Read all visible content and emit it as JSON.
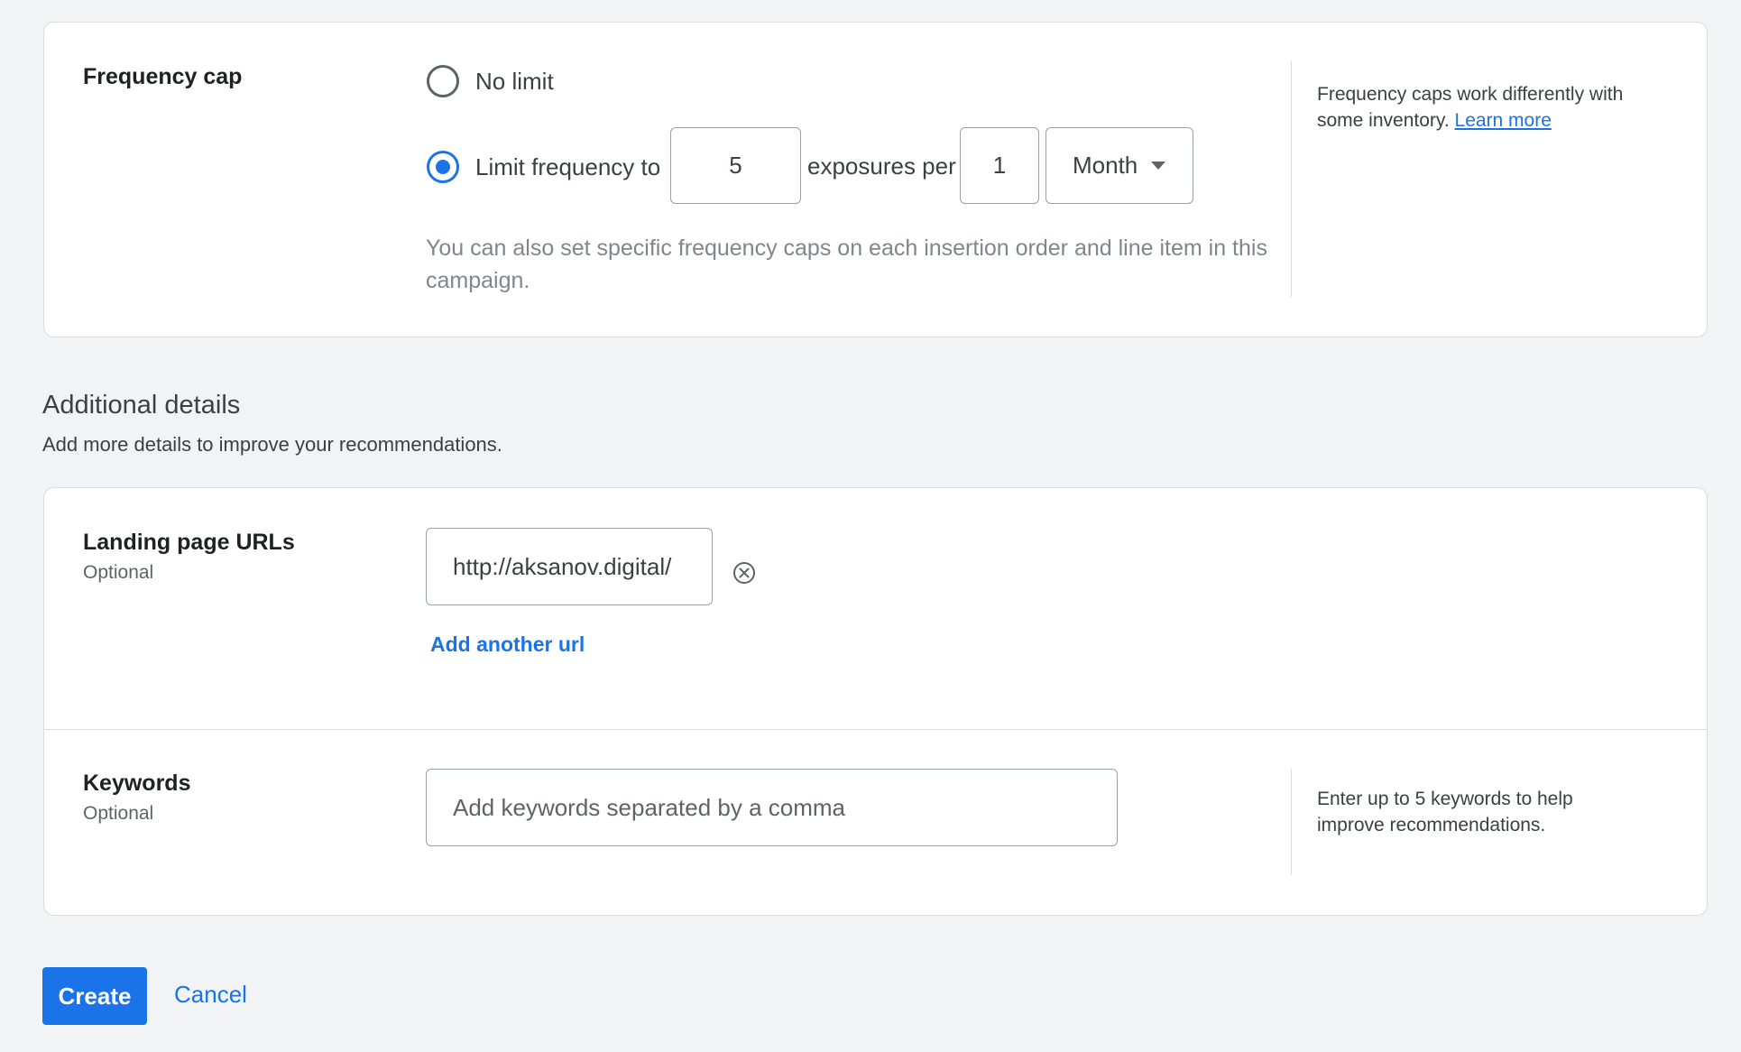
{
  "frequency": {
    "title": "Frequency cap",
    "options": [
      {
        "label": "No limit",
        "selected": false
      },
      {
        "label": "Limit frequency to",
        "selected": true
      }
    ],
    "exposures_value": "5",
    "exposures_label": "exposures per",
    "period_count": "1",
    "period_unit": "Month",
    "hint": "You can also set specific frequency caps on each insertion order and line item in this campaign.",
    "help_text": "Frequency caps work differently with some inventory.",
    "help_link": "Learn more"
  },
  "additional": {
    "title": "Additional details",
    "subtitle": "Add more details to improve your recommendations."
  },
  "landing": {
    "title": "Landing page URLs",
    "optional": "Optional",
    "url_value": "http://aksanov.digital/",
    "add_link": "Add another url"
  },
  "keywords": {
    "title": "Keywords",
    "optional": "Optional",
    "placeholder": "Add keywords separated by a comma",
    "help_text": "Enter up to 5 keywords to help improve recommendations."
  },
  "actions": {
    "create": "Create",
    "cancel": "Cancel"
  },
  "colors": {
    "accent": "#1a73e8",
    "background": "#f1f3f4"
  }
}
